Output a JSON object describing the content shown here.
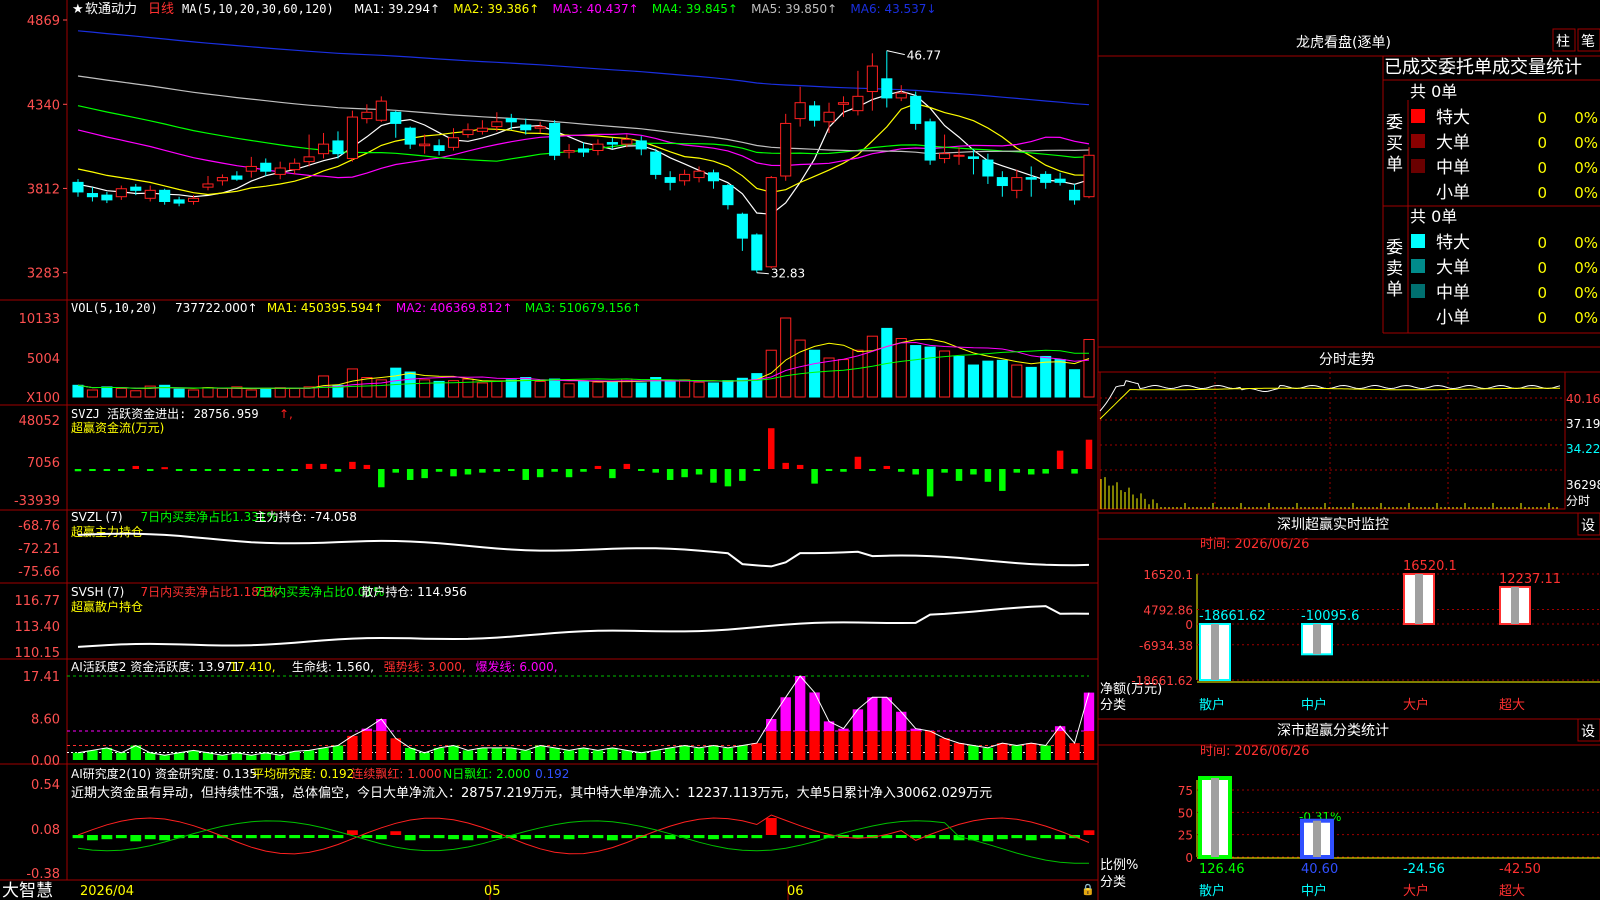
{
  "app": {
    "brand": "大智慧",
    "stock_name": "软通动力",
    "period": "日线",
    "star": "★",
    "date_marks": [
      "2026/04",
      "05",
      "06"
    ]
  },
  "colors": {
    "up": "#ff2020",
    "down": "#00ffff",
    "ma1": "#ffffff",
    "ma2": "#ffff00",
    "ma3": "#ff00ff",
    "ma4": "#00ff00",
    "ma5": "#c0c0c0",
    "ma6": "#1a2fe0",
    "grid": "#a00000",
    "axis_text": "#ff5050"
  },
  "price_panel": {
    "header": "MA(5,10,20,30,60,120)",
    "ma_labels": [
      {
        "text": "MA1: 39.294",
        "arrow": "↑",
        "color": "#ffffff"
      },
      {
        "text": "MA2: 39.386",
        "arrow": "↑",
        "color": "#ffff00"
      },
      {
        "text": "MA3: 40.437",
        "arrow": "↑",
        "color": "#ff00ff"
      },
      {
        "text": "MA4: 39.845",
        "arrow": "↑",
        "color": "#00ff00"
      },
      {
        "text": "MA5: 39.850",
        "arrow": "↑",
        "color": "#c0c0c0"
      },
      {
        "text": "MA6: 43.537",
        "arrow": "↓",
        "color": "#1a2fe0"
      }
    ],
    "y_ticks": [
      "4869",
      "4340",
      "3812",
      "3283"
    ],
    "high_label": "46.77",
    "low_label": "32.83"
  },
  "vol_panel": {
    "header": "VOL(5,10,20)",
    "labels": [
      {
        "text": "737722.000",
        "arrow": "↑",
        "color": "#ffffff"
      },
      {
        "text": "MA1: 450395.594",
        "arrow": "↑",
        "color": "#ffff00"
      },
      {
        "text": "MA2: 406369.812",
        "arrow": "↑",
        "color": "#ff00ff"
      },
      {
        "text": "MA3: 510679.156",
        "arrow": "↑",
        "color": "#00ff00"
      }
    ],
    "y_ticks": [
      "10133",
      "5004",
      "X100"
    ]
  },
  "svzj_panel": {
    "line1": "SVZJ  活跃资金进出: 28756.959",
    "line2": "超赢资金流(万元)",
    "y_ticks": [
      "48052",
      "7056",
      "-33939"
    ]
  },
  "svzl_panel": {
    "labels": [
      {
        "text": "SVZL (7)",
        "color": "#ffffff"
      },
      {
        "text": "7日内买卖净占比1.331%",
        "color": "#00ff00"
      },
      {
        "text": "主力持仓: -74.058",
        "color": "#ffffff"
      }
    ],
    "line2": "超赢主力持仓",
    "y_ticks": [
      "-68.76",
      "-72.21",
      "-75.66"
    ]
  },
  "svsh_panel": {
    "labels": [
      {
        "text": "SVSH (7)",
        "color": "#ffffff"
      },
      {
        "text": "7日内买卖净占比1.185%",
        "color": "#ff3030"
      },
      {
        "text": "7日内买卖净占比0.01%",
        "color": "#00ff00"
      },
      {
        "text": "散户持仓: 114.956",
        "color": "#ffffff"
      }
    ],
    "line2": "超赢散户持仓",
    "y_ticks": [
      "116.77",
      "113.40",
      "110.15"
    ]
  },
  "ai_panel": {
    "labels": [
      {
        "text": "AI活跃度2 资金活跃度: 13.971",
        "color": "#ffffff"
      },
      {
        "text": "17.410,",
        "color": "#ffff00"
      },
      {
        "text": "生命线: 1.560,",
        "color": "#ffffff"
      },
      {
        "text": "强势线: 3.000,",
        "color": "#ff3030"
      },
      {
        "text": "爆发线: 6.000,",
        "color": "#ff00ff"
      }
    ],
    "y_ticks": [
      "17.41",
      "8.60",
      "0.00"
    ]
  },
  "research_panel": {
    "labels": [
      {
        "text": "AI研究度2(10) 资金研究度: 0.135",
        "color": "#ffffff"
      },
      {
        "text": "平均研究度: 0.192",
        "color": "#ffff00"
      },
      {
        "text": "连续飘红: 1.000",
        "color": "#ff3030"
      },
      {
        "text": "N日飘红: 2.000",
        "color": "#00ff00"
      },
      {
        "text": "0.192",
        "color": "#3050ff"
      }
    ],
    "comment": "近期大资金虽有异动，但持续性不强，总体偏空，今日大单净流入：28757.219万元，其中特大单净流入：12237.113万元，大单5日累计净入30062.029万元",
    "y_ticks": [
      "0.54",
      "0.08",
      "-0.38"
    ]
  },
  "right_panel": {
    "lhb_title": "龙虎看盘(逐单)",
    "btn1": "柱",
    "btn2": "笔",
    "stats_title": "已成交委托单成交量统计",
    "buy_label": "委买单",
    "sell_label": "委卖单",
    "buy_total": "共 0单",
    "sell_total": "共 0单",
    "buy_rows": [
      {
        "name": "特大",
        "count": "0",
        "pct": "0%",
        "color": "#ff0000"
      },
      {
        "name": "大单",
        "count": "0",
        "pct": "0%",
        "color": "#8b0000"
      },
      {
        "name": "中单",
        "count": "0",
        "pct": "0%",
        "color": "#6a0000"
      },
      {
        "name": "小单",
        "count": "0",
        "pct": "0%",
        "color": ""
      }
    ],
    "sell_rows": [
      {
        "name": "特大",
        "count": "0",
        "pct": "0%",
        "color": "#00ffff"
      },
      {
        "name": "大单",
        "count": "0",
        "pct": "0%",
        "color": "#008b8b"
      },
      {
        "name": "中单",
        "count": "0",
        "pct": "0%",
        "color": "#007070"
      },
      {
        "name": "小单",
        "count": "0",
        "pct": "0%",
        "color": ""
      }
    ],
    "intraday_title": "分时走势",
    "intraday_ticks": [
      "40.16",
      "37.19",
      "34.22",
      "36298",
      "分时"
    ],
    "monitor_title": "深圳超赢实时监控",
    "monitor_btn": "设",
    "monitor_time": "时间: 2026/06/26",
    "monitor_y_ticks": [
      "16520.1",
      "4792.86",
      "0",
      "-6934.38",
      "-18661.62"
    ],
    "monitor_ylabel": "净额(万元)",
    "monitor_xlabel": "分类",
    "monitor_categories": [
      "散户",
      "中户",
      "大户",
      "超大"
    ],
    "monitor_values": [
      -18661.62,
      -10095.6,
      16520.1,
      12237.11
    ],
    "monitor_value_labels": [
      "-18661.62",
      "-10095.6",
      "16520.1",
      "12237.11"
    ],
    "class_title": "深市超赢分类统计",
    "class_btn": "设",
    "class_time": "时间: 2026/06/26",
    "class_y_ticks": [
      "75",
      "50",
      "25",
      "0"
    ],
    "class_ylabel": "比例%",
    "class_xlabel": "分类",
    "class_categories": [
      "散户",
      "中户",
      "大户",
      "超大"
    ],
    "class_values": [
      126.46,
      40.6,
      -24.56,
      -42.5
    ],
    "class_value_labels": [
      "126.46",
      "40.60",
      "-24.56",
      "-42.50"
    ],
    "class_top_label": "-0.31%"
  },
  "chart_data": [
    {
      "type": "candlestick",
      "title": "软通动力 日线",
      "ylim": [
        32.0,
        49.0
      ],
      "high": 46.77,
      "low": 32.83,
      "candles": [
        [
          38.5,
          37.9,
          38.7,
          37.6
        ],
        [
          37.8,
          37.6,
          38.2,
          37.3
        ],
        [
          37.7,
          37.4,
          37.9,
          37.2
        ],
        [
          37.6,
          38.1,
          38.3,
          37.4
        ],
        [
          38.2,
          38.0,
          38.4,
          37.7
        ],
        [
          37.5,
          38.0,
          38.3,
          37.3
        ],
        [
          38.0,
          37.3,
          38.1,
          37.1
        ],
        [
          37.4,
          37.2,
          37.6,
          37.0
        ],
        [
          37.3,
          37.5,
          37.7,
          37.1
        ],
        [
          38.2,
          38.4,
          38.9,
          38.0
        ],
        [
          38.6,
          38.8,
          39.0,
          38.3
        ],
        [
          38.9,
          38.7,
          39.2,
          38.6
        ],
        [
          39.2,
          39.5,
          40.1,
          38.8
        ],
        [
          39.7,
          39.2,
          40.0,
          38.9
        ],
        [
          39.0,
          39.4,
          39.8,
          38.7
        ],
        [
          39.3,
          39.7,
          40.0,
          39.0
        ],
        [
          39.8,
          40.1,
          41.5,
          39.5
        ],
        [
          40.3,
          40.9,
          41.6,
          40.0
        ],
        [
          41.1,
          40.3,
          41.7,
          40.0
        ],
        [
          40.0,
          42.6,
          43.0,
          39.8
        ],
        [
          42.5,
          42.9,
          43.4,
          42.2
        ],
        [
          42.4,
          43.6,
          43.9,
          42.3
        ],
        [
          42.9,
          42.2,
          43.0,
          41.3
        ],
        [
          41.9,
          40.9,
          42.0,
          40.6
        ],
        [
          40.8,
          40.9,
          41.5,
          40.3
        ],
        [
          40.8,
          40.5,
          41.2,
          40.2
        ],
        [
          40.7,
          41.3,
          41.9,
          40.5
        ],
        [
          41.5,
          41.8,
          42.2,
          41.3
        ],
        [
          41.7,
          41.9,
          42.4,
          41.5
        ],
        [
          42.0,
          42.3,
          42.9,
          41.7
        ],
        [
          42.5,
          42.3,
          42.8,
          41.8
        ],
        [
          42.1,
          41.8,
          42.5,
          41.5
        ],
        [
          41.9,
          42.0,
          42.3,
          41.6
        ],
        [
          42.2,
          40.2,
          42.4,
          39.9
        ],
        [
          40.4,
          40.5,
          40.9,
          40.0
        ],
        [
          40.6,
          40.4,
          41.0,
          40.1
        ],
        [
          40.5,
          40.9,
          41.2,
          40.2
        ],
        [
          41.0,
          40.9,
          41.3,
          40.6
        ],
        [
          40.9,
          41.2,
          41.5,
          40.7
        ],
        [
          41.1,
          40.6,
          41.4,
          40.2
        ],
        [
          40.4,
          39.0,
          40.6,
          38.7
        ],
        [
          38.8,
          38.5,
          39.2,
          38.0
        ],
        [
          38.6,
          39.0,
          39.3,
          38.3
        ],
        [
          38.8,
          39.2,
          39.5,
          38.5
        ],
        [
          39.1,
          38.6,
          39.3,
          38.1
        ],
        [
          38.3,
          37.1,
          38.4,
          36.8
        ],
        [
          36.5,
          35.0,
          36.6,
          34.2
        ],
        [
          35.2,
          33.0,
          35.3,
          32.83
        ],
        [
          33.2,
          38.8,
          38.9,
          33.1
        ],
        [
          38.9,
          42.2,
          42.8,
          38.6
        ],
        [
          42.5,
          43.5,
          44.5,
          42.0
        ],
        [
          43.3,
          42.4,
          43.6,
          42.0
        ],
        [
          42.3,
          42.9,
          43.5,
          41.6
        ],
        [
          43.4,
          43.5,
          43.9,
          42.6
        ],
        [
          43.0,
          43.9,
          45.5,
          42.7
        ],
        [
          44.2,
          45.8,
          46.6,
          43.0
        ],
        [
          45.0,
          43.8,
          46.77,
          43.2
        ],
        [
          43.8,
          44.1,
          44.6,
          43.6
        ],
        [
          43.9,
          42.2,
          44.2,
          41.8
        ],
        [
          42.3,
          39.9,
          42.5,
          39.6
        ],
        [
          40.0,
          40.3,
          41.5,
          39.7
        ],
        [
          40.2,
          40.2,
          40.7,
          39.6
        ],
        [
          40.1,
          40.0,
          40.6,
          39.0
        ],
        [
          39.9,
          38.9,
          40.3,
          38.4
        ],
        [
          38.8,
          38.3,
          39.2,
          37.6
        ],
        [
          38.0,
          38.8,
          39.3,
          37.5
        ],
        [
          38.8,
          38.7,
          39.5,
          37.6
        ],
        [
          39.0,
          38.5,
          39.2,
          38.1
        ],
        [
          38.7,
          38.5,
          39.1,
          38.3
        ],
        [
          38.0,
          37.4,
          38.4,
          37.1
        ],
        [
          37.6,
          40.2,
          40.7,
          37.5
        ]
      ]
    },
    {
      "type": "bar",
      "title": "VOL(5,10,20)",
      "ylim": [
        0,
        12000
      ],
      "values": [
        1500,
        900,
        1300,
        1100,
        800,
        1400,
        1500,
        1000,
        900,
        1200,
        1100,
        1300,
        900,
        1000,
        1200,
        1100,
        1300,
        2700,
        1500,
        3600,
        2500,
        2200,
        3700,
        3200,
        2200,
        2000,
        2100,
        2300,
        1800,
        2000,
        2200,
        2500,
        2000,
        2300,
        1700,
        2000,
        1900,
        2000,
        2300,
        1800,
        2500,
        2000,
        2200,
        1900,
        1800,
        2100,
        2400,
        3000,
        6000,
        10133,
        7300,
        6000,
        5000,
        4800,
        6000,
        7800,
        8800,
        7500,
        6600,
        6400,
        5900,
        5200,
        4100,
        4600,
        4700,
        4100,
        3800,
        5200,
        4800,
        3500,
        7377
      ],
      "up": [
        0,
        1,
        0,
        1,
        1,
        1,
        0,
        0,
        1,
        1,
        1,
        1,
        1,
        0,
        1,
        1,
        1,
        1,
        0,
        1,
        1,
        1,
        0,
        0,
        1,
        0,
        1,
        1,
        1,
        1,
        0,
        0,
        1,
        0,
        1,
        0,
        1,
        0,
        1,
        0,
        0,
        0,
        1,
        1,
        0,
        0,
        0,
        0,
        1,
        1,
        1,
        0,
        1,
        1,
        1,
        1,
        0,
        1,
        0,
        0,
        1,
        0,
        0,
        0,
        0,
        1,
        0,
        0,
        0,
        0,
        1
      ]
    },
    {
      "type": "bar",
      "title": "超赢资金流(万元)",
      "ylim": [
        -33939,
        48052
      ],
      "values": [
        -2500,
        -2000,
        -1500,
        -1800,
        3000,
        -1000,
        1800,
        -1500,
        -2000,
        -1000,
        -1500,
        -1200,
        -1600,
        -900,
        -2000,
        -1000,
        5000,
        5000,
        -3000,
        7000,
        4000,
        -20000,
        -4000,
        -12000,
        -10000,
        -3000,
        -8000,
        -6000,
        -4000,
        -3000,
        -2000,
        -12000,
        -9000,
        -3000,
        -9000,
        -3000,
        3000,
        -10000,
        5000,
        -2000,
        -4000,
        -12000,
        -9000,
        -6000,
        -15000,
        -19000,
        -13000,
        -2000,
        40000,
        6000,
        4000,
        -16000,
        -2000,
        -3000,
        12000,
        -2000,
        3000,
        -3000,
        -6000,
        -30000,
        -4000,
        -13000,
        -6000,
        -14000,
        -24000,
        -4000,
        -6000,
        -5000,
        18000,
        -5000,
        28757
      ]
    },
    {
      "type": "line",
      "title": "超赢主力持仓",
      "ylim": [
        -75.66,
        -68.76
      ],
      "y_start": -70.5,
      "y_end": -74.06
    },
    {
      "type": "line",
      "title": "超赢散户持仓",
      "ylim": [
        110.15,
        116.77
      ],
      "y_start": 110.8,
      "y_end": 114.96
    },
    {
      "type": "bar",
      "title": "AI活跃度2",
      "ylim": [
        0,
        17.41
      ],
      "lines": {
        "生命线": 1.56,
        "强势线": 3.0,
        "爆发线": 6.0
      },
      "values": [
        1.5,
        2.0,
        2.5,
        1.5,
        3.0,
        1.5,
        1.0,
        1.5,
        2.0,
        1.5,
        1.0,
        1.5,
        1.0,
        1.5,
        1.0,
        1.8,
        2.0,
        2.5,
        3.0,
        5.0,
        6.5,
        8.5,
        4.5,
        2.5,
        1.5,
        2.5,
        3.0,
        2.0,
        2.5,
        2.5,
        2.5,
        2.0,
        3.0,
        2.5,
        2.0,
        2.5,
        2.0,
        2.5,
        2.0,
        1.5,
        2.0,
        2.5,
        3.0,
        2.5,
        3.0,
        2.5,
        3.0,
        3.5,
        8.5,
        13.0,
        17.41,
        14.0,
        8.0,
        6.5,
        10.5,
        13.0,
        13.0,
        10.0,
        6.5,
        6.0,
        4.5,
        3.5,
        3.0,
        2.5,
        3.5,
        3.0,
        3.5,
        3.0,
        7.0,
        3.5,
        13.97
      ]
    },
    {
      "type": "bar",
      "title": "AI研究度2(10)",
      "ylim": [
        -0.38,
        0.54
      ],
      "values": [
        -0.03,
        -0.05,
        -0.04,
        -0.03,
        -0.06,
        -0.04,
        -0.05,
        -0.03,
        -0.02,
        -0.01,
        -0.03,
        -0.02,
        -0.03,
        -0.03,
        -0.02,
        -0.03,
        -0.02,
        -0.01,
        -0.03,
        0.05,
        -0.02,
        -0.04,
        0.04,
        -0.05,
        -0.03,
        -0.03,
        -0.04,
        -0.05,
        -0.03,
        -0.02,
        -0.03,
        -0.04,
        -0.02,
        -0.03,
        -0.04,
        -0.02,
        -0.03,
        -0.05,
        -0.03,
        -0.02,
        -0.03,
        -0.04,
        -0.02,
        -0.03,
        -0.04,
        -0.03,
        -0.02,
        -0.03,
        0.18,
        -0.02,
        -0.03,
        -0.02,
        -0.03,
        -0.02,
        -0.02,
        -0.03,
        -0.03,
        -0.02,
        -0.03,
        -0.03,
        -0.04,
        -0.05,
        -0.05,
        -0.06,
        -0.04,
        -0.03,
        -0.05,
        -0.03,
        -0.04,
        -0.03,
        0.05
      ]
    }
  ]
}
